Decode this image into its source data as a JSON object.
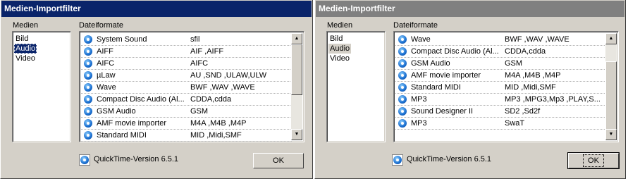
{
  "dialogs": [
    {
      "title": "Medien-Importfilter",
      "media_label": "Medien",
      "formats_label": "Dateiformate",
      "media": [
        "Bild",
        "Audio",
        "Video"
      ],
      "formats": [
        {
          "name": "System Sound",
          "ext": "sfil"
        },
        {
          "name": "AIFF",
          "ext": "AIF ,AIFF"
        },
        {
          "name": "AIFC",
          "ext": "AIFC"
        },
        {
          "name": "µLaw",
          "ext": "AU  ,SND ,ULAW,ULW"
        },
        {
          "name": "Wave",
          "ext": "BWF ,WAV ,WAVE"
        },
        {
          "name": "Compact Disc Audio (Al...",
          "ext": "CDDA,cdda"
        },
        {
          "name": "GSM Audio",
          "ext": "GSM"
        },
        {
          "name": "AMF movie importer",
          "ext": "M4A ,M4B ,M4P"
        },
        {
          "name": "Standard MIDI",
          "ext": "MID ,Midi,SMF"
        }
      ],
      "version": "QuickTime-Version 6.5.1",
      "ok_label": "OK"
    },
    {
      "title": "Medien-Importfilter",
      "media_label": "Medien",
      "formats_label": "Dateiformate",
      "media": [
        "Bild",
        "Audio",
        "Video"
      ],
      "formats": [
        {
          "name": "Wave",
          "ext": "BWF ,WAV ,WAVE"
        },
        {
          "name": "Compact Disc Audio (Al...",
          "ext": "CDDA,cdda"
        },
        {
          "name": "GSM Audio",
          "ext": "GSM"
        },
        {
          "name": "AMF movie importer",
          "ext": "M4A ,M4B ,M4P"
        },
        {
          "name": "Standard MIDI",
          "ext": "MID ,Midi,SMF"
        },
        {
          "name": "MP3",
          "ext": "MP3 ,MPG3,Mp3 ,PLAY,S..."
        },
        {
          "name": "Sound Designer II",
          "ext": "SD2 ,Sd2f"
        },
        {
          "name": "MP3",
          "ext": "SwaT"
        }
      ],
      "version": "QuickTime-Version 6.5.1",
      "ok_label": "OK"
    }
  ],
  "icons": {
    "format_icon": "quicktime-icon",
    "scroll_up": "arrow-up-icon",
    "scroll_down": "arrow-down-icon"
  },
  "colors": {
    "active_titlebar": "#0a246a",
    "inactive_titlebar": "#808080",
    "dialog_bg": "#d4d0c8"
  }
}
